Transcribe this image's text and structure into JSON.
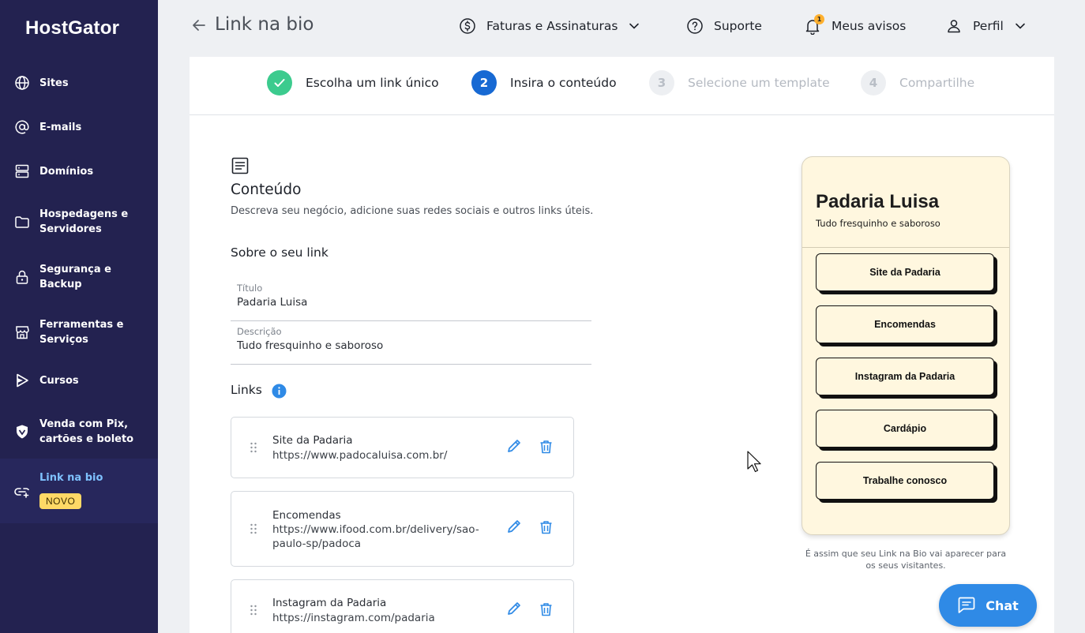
{
  "brand": {
    "logo_text": "HostGator"
  },
  "sidebar": {
    "items": [
      {
        "label": "Sites",
        "icon": "globe-icon"
      },
      {
        "label": "E-mails",
        "icon": "at-sign-icon"
      },
      {
        "label": "Domínios",
        "icon": "server-icon"
      },
      {
        "label": "Hospedagens e Servidores",
        "icon": "folder-icon"
      },
      {
        "label": "Segurança e Backup",
        "icon": "lock-icon"
      },
      {
        "label": "Ferramentas e Serviços",
        "icon": "store-icon"
      },
      {
        "label": "Cursos",
        "icon": "play-icon"
      },
      {
        "label": "Venda com Pix, cartões e boleto",
        "icon": "shield-icon"
      },
      {
        "label": "Link na bio",
        "icon": "link-icon",
        "badge": "NOVO",
        "active": true
      }
    ]
  },
  "header": {
    "title": "Link na bio",
    "billing_label": "Faturas e Assinaturas",
    "support_label": "Suporte",
    "notifications_label": "Meus avisos",
    "notifications_count": "1",
    "profile_label": "Perfil"
  },
  "stepper": {
    "steps": [
      {
        "number": "1",
        "label": "Escolha um link único",
        "state": "done"
      },
      {
        "number": "2",
        "label": "Insira o conteúdo",
        "state": "current"
      },
      {
        "number": "3",
        "label": "Selecione um template",
        "state": "todo"
      },
      {
        "number": "4",
        "label": "Compartilhe",
        "state": "todo"
      }
    ]
  },
  "content": {
    "title": "Conteúdo",
    "description": "Descreva seu negócio, adicione suas redes sociais e outros links úteis.",
    "about_title": "Sobre o seu link",
    "title_field": {
      "label": "Título",
      "value": "Padaria Luisa"
    },
    "description_field": {
      "label": "Descrição",
      "value": "Tudo fresquinho e saboroso"
    },
    "links_title": "Links",
    "links": [
      {
        "title": "Site da Padaria",
        "url": "https://www.padocaluisa.com.br/"
      },
      {
        "title": "Encomendas",
        "url": "https://www.ifood.com.br/delivery/sao-paulo-sp/padoca"
      },
      {
        "title": "Instagram da Padaria",
        "url": "https://instagram.com/padaria"
      }
    ]
  },
  "preview": {
    "title": "Padaria Luisa",
    "description": "Tudo fresquinho e saboroso",
    "buttons": [
      "Site da Padaria",
      "Encomendas",
      "Instagram da Padaria",
      "Cardápio",
      "Trabalhe conosco"
    ],
    "caption": "É assim que seu Link na Bio vai aparecer para os seus visitantes."
  },
  "chat": {
    "label": "Chat"
  },
  "colors": {
    "sidebar_bg": "#232250",
    "active_accent": "#56a8ff",
    "step_done": "#3ccb8e",
    "step_current": "#1769d3",
    "action_blue": "#2f8ae6",
    "preview_bg": "#fff7df",
    "badge_yellow": "#ffd966"
  }
}
